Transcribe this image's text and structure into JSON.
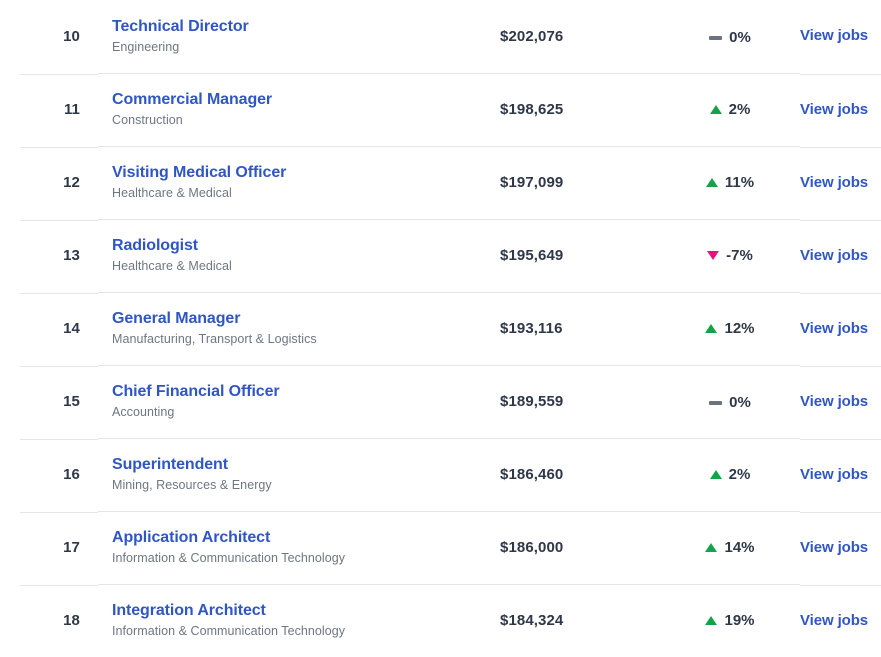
{
  "list": {
    "action_label": "View jobs",
    "colors": {
      "link": "#3056c4",
      "text": "#2e3849",
      "muted": "#6e7781",
      "up": "#15a34a",
      "down": "#e8117f",
      "flat": "#6b7280",
      "divider": "#e4e5e7"
    },
    "rows": [
      {
        "rank": "10",
        "title": "Technical Director",
        "category": "Engineering",
        "salary": "$202,076",
        "change": "0%",
        "trend": "flat",
        "trend_icon": "flat-dash-icon",
        "action": "View jobs"
      },
      {
        "rank": "11",
        "title": "Commercial Manager",
        "category": "Construction",
        "salary": "$198,625",
        "change": "2%",
        "trend": "up",
        "trend_icon": "triangle-up-icon",
        "action": "View jobs"
      },
      {
        "rank": "12",
        "title": "Visiting Medical Officer",
        "category": "Healthcare & Medical",
        "salary": "$197,099",
        "change": "11%",
        "trend": "up",
        "trend_icon": "triangle-up-icon",
        "action": "View jobs"
      },
      {
        "rank": "13",
        "title": "Radiologist",
        "category": "Healthcare & Medical",
        "salary": "$195,649",
        "change": "-7%",
        "trend": "down",
        "trend_icon": "triangle-down-icon",
        "action": "View jobs"
      },
      {
        "rank": "14",
        "title": "General Manager",
        "category": "Manufacturing, Transport & Logistics",
        "salary": "$193,116",
        "change": "12%",
        "trend": "up",
        "trend_icon": "triangle-up-icon",
        "action": "View jobs"
      },
      {
        "rank": "15",
        "title": "Chief Financial Officer",
        "category": "Accounting",
        "salary": "$189,559",
        "change": "0%",
        "trend": "flat",
        "trend_icon": "flat-dash-icon",
        "action": "View jobs"
      },
      {
        "rank": "16",
        "title": "Superintendent",
        "category": "Mining, Resources & Energy",
        "salary": "$186,460",
        "change": "2%",
        "trend": "up",
        "trend_icon": "triangle-up-icon",
        "action": "View jobs"
      },
      {
        "rank": "17",
        "title": "Application Architect",
        "category": "Information & Communication Technology",
        "salary": "$186,000",
        "change": "14%",
        "trend": "up",
        "trend_icon": "triangle-up-icon",
        "action": "View jobs"
      },
      {
        "rank": "18",
        "title": "Integration Architect",
        "category": "Information & Communication Technology",
        "salary": "$184,324",
        "change": "19%",
        "trend": "up",
        "trend_icon": "triangle-up-icon",
        "action": "View jobs"
      }
    ]
  }
}
